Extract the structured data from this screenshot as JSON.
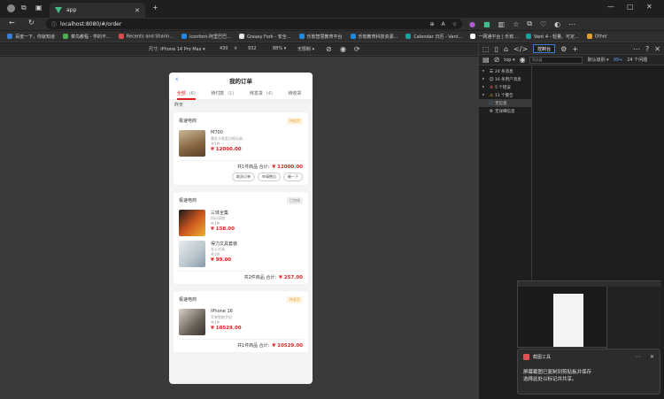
{
  "browser": {
    "tab_title": "app",
    "url": "localhost:8080/#/order",
    "bookmarks": [
      "百度一下，你就知道",
      "菜鸟教程 - 学的不...",
      "Recents and Sharin...",
      "iconfont-阿里巴巴...",
      "Greasy Fork - 安全...",
      "乐软智慧教育平台",
      "乐软教育科技资源...",
      "Calendar 日历 - Vant...",
      "一网通平台 | 乐软...",
      "Vant 4 - 轻量、可定...",
      "Other"
    ],
    "bookmark_colors": [
      "#3b7dd8",
      "#4caf50",
      "#e04a4a",
      "#1e88e5",
      "#e6e6e6",
      "#1e88e5",
      "#1e88e5",
      "#1aa3a3",
      "#ffffff",
      "#1aa3a3",
      "#e0a030"
    ]
  },
  "device_toolbar": {
    "device": "尺寸: iPhone 14 Pro Max",
    "width": "430",
    "height": "932",
    "zoom": "88%",
    "throttle": "无限制"
  },
  "phone": {
    "header": {
      "back": "‹",
      "title": "我的订单"
    },
    "tabs": [
      {
        "label": "全部",
        "count": "(6)"
      },
      {
        "label": "待付款",
        "count": "(1)"
      },
      {
        "label": "待发货",
        "count": "(4)"
      },
      {
        "label": "待收货",
        "count": ""
      }
    ],
    "day_label": "昨天",
    "orders": [
      {
        "shop": "极速电商",
        "status": "待发货",
        "status_type": "paid",
        "items": [
          {
            "name": "M700",
            "desc": "雷丝卡款狙击枪玩具…",
            "qty": "共1件",
            "price": "¥ 12000.00",
            "img_color": "#8a6a44"
          }
        ],
        "total_label": "共1件商品 合计:",
        "total": "¥ 12000.00",
        "actions": [
          "取消订单",
          "申请售后",
          "催一下"
        ]
      },
      {
        "shop": "极速电商",
        "status": "已完成",
        "status_type": "done",
        "items": [
          {
            "name": "三体全集",
            "desc": "科幻读物",
            "qty": "共1件",
            "price": "¥ 158.00",
            "img_color": "#c8541e"
          },
          {
            "name": "得力文具套装",
            "desc": "办公文具",
            "qty": "共1件",
            "price": "¥ 99.00",
            "img_color": "#b8c4cc"
          }
        ],
        "total_label": "共2件商品 合计:",
        "total": "¥ 257.00",
        "actions": []
      },
      {
        "shop": "极速电商",
        "status": "待发货",
        "status_type": "paid",
        "items": [
          {
            "name": "iPhone 16",
            "desc": "苹果智能手机",
            "qty": "共1件",
            "price": "¥ 10529.00",
            "img_color": "#6b6258"
          }
        ],
        "total_label": "共1件商品 合计:",
        "total": "¥ 10529.00",
        "actions": []
      }
    ]
  },
  "devtools": {
    "console_tab": "控制台",
    "top": "top",
    "filter_placeholder": "筛选器",
    "levels": "默认级别",
    "issues": "99+",
    "hidden": "24 个问题",
    "sidebar": [
      {
        "label": "24 条消息",
        "sym": "☰",
        "color": "#cccccc",
        "arrow": "▸"
      },
      {
        "label": "16 条用户消息",
        "sym": "👤",
        "color": "#cccccc",
        "arrow": "▸"
      },
      {
        "label": "5 个错误",
        "sym": "⊗",
        "color": "#e05555",
        "arrow": "▸"
      },
      {
        "label": "11 个警告",
        "sym": "⚠",
        "color": "#e0b030",
        "arrow": "▸"
      },
      {
        "label": "无信息",
        "sym": "ⓘ",
        "color": "#5aa0e6",
        "arrow": ""
      },
      {
        "label": "无详细信息",
        "sym": "⚙",
        "color": "#cccccc",
        "arrow": ""
      }
    ]
  },
  "toast": {
    "app": "截图工具",
    "message_line1": "屏幕截图已复制到剪贴板并保存",
    "message_line2": "选择此处以标记并共享。"
  }
}
